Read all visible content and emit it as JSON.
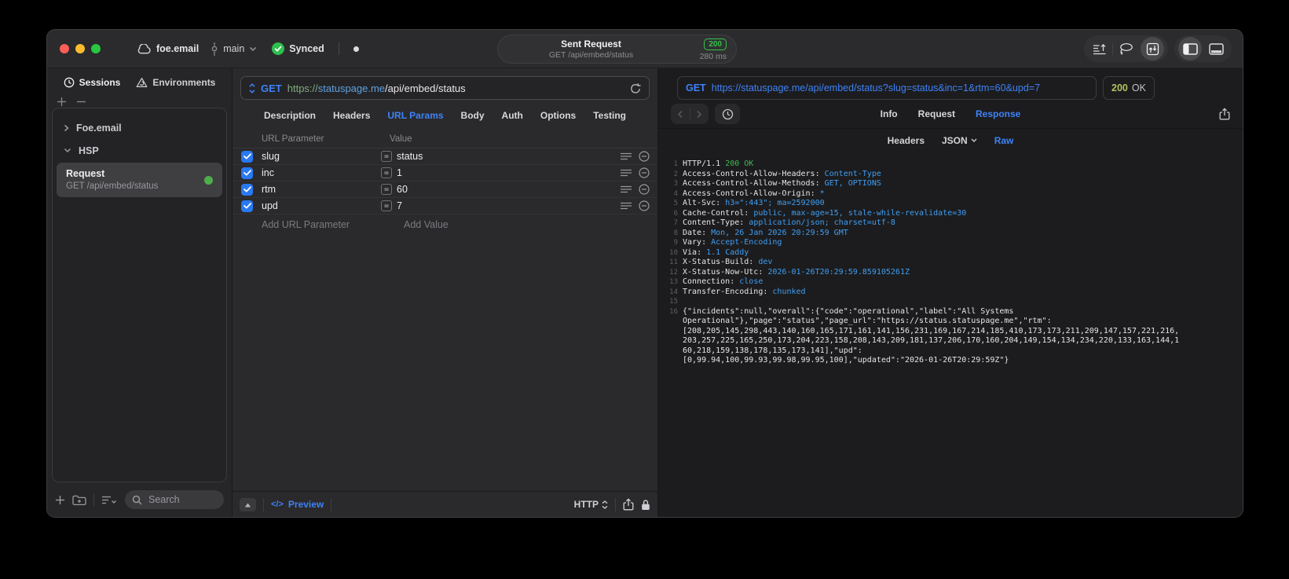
{
  "titlebar": {
    "project": "foe.email",
    "branch": "main",
    "synced_label": "Synced",
    "sent_request": {
      "title": "Sent Request",
      "status_code": "200",
      "subtitle": "GET /api/embed/status",
      "duration": "280 ms"
    },
    "icons": [
      "export-lines-icon",
      "lasso-icon",
      "sync-box-icon",
      "panel-left-icon",
      "panel-bottom-icon"
    ]
  },
  "sidebar": {
    "tabs": [
      {
        "label": "Sessions",
        "icon": "clock-icon",
        "active": true
      },
      {
        "label": "Environments",
        "icon": "environments-icon",
        "active": false
      }
    ],
    "groups": [
      {
        "label": "Foe.email",
        "expanded": false
      },
      {
        "label": "HSP",
        "expanded": true
      }
    ],
    "request_item": {
      "title": "Request",
      "subtitle": "GET /api/embed/status",
      "status_dot_color": "#4fae4c"
    },
    "search_placeholder": "Search"
  },
  "request_editor": {
    "method": "GET",
    "url": {
      "scheme": "https://",
      "host": "statuspage.me",
      "path": "/api/embed/status"
    },
    "tabs": [
      "Description",
      "Headers",
      "URL Params",
      "Body",
      "Auth",
      "Options",
      "Testing"
    ],
    "active_tab": "URL Params",
    "params": {
      "col_param": "URL Parameter",
      "col_value": "Value",
      "operator": "=",
      "rows": [
        {
          "name": "slug",
          "value": "status",
          "checked": true
        },
        {
          "name": "inc",
          "value": "1",
          "checked": true
        },
        {
          "name": "rtm",
          "value": "60",
          "checked": true
        },
        {
          "name": "upd",
          "value": "7",
          "checked": true
        }
      ],
      "add_param": "Add URL Parameter",
      "add_value": "Add Value"
    },
    "footer": {
      "code_glyph": "</>",
      "preview": "Preview",
      "http": "HTTP"
    }
  },
  "response_viewer": {
    "method": "GET",
    "url": "https://statuspage.me/api/embed/status?slug=status&inc=1&rtm=60&upd=7",
    "status_code": "200",
    "status_text": "OK",
    "tabs": [
      "Info",
      "Request",
      "Response"
    ],
    "active_tab": "Response",
    "subtabs": [
      "Headers",
      "JSON",
      "Raw"
    ],
    "active_subtab": "Raw",
    "separator": ": ",
    "http_line": {
      "prefix": "HTTP/1.1 ",
      "status": "200 OK"
    },
    "headers": [
      {
        "name": "Access-Control-Allow-Headers",
        "value": "Content-Type"
      },
      {
        "name": "Access-Control-Allow-Methods",
        "value": "GET, OPTIONS"
      },
      {
        "name": "Access-Control-Allow-Origin",
        "value": "*"
      },
      {
        "name": "Alt-Svc",
        "value": "h3=\":443\"; ma=2592000"
      },
      {
        "name": "Cache-Control",
        "value": "public, max-age=15, stale-while-revalidate=30"
      },
      {
        "name": "Content-Type",
        "value": "application/json; charset=utf-8"
      },
      {
        "name": "Date",
        "value": "Mon, 26 Jan 2026 20:29:59 GMT"
      },
      {
        "name": "Vary",
        "value": "Accept-Encoding"
      },
      {
        "name": "Via",
        "value": "1.1 Caddy"
      },
      {
        "name": "X-Status-Build",
        "value": "dev"
      },
      {
        "name": "X-Status-Now-Utc",
        "value": "2026-01-26T20:29:59.859105261Z"
      },
      {
        "name": "Connection",
        "value": "close"
      },
      {
        "name": "Transfer-Encoding",
        "value": "chunked"
      }
    ],
    "body_line_number": 16,
    "body_lines": [
      "{\"incidents\":null,\"overall\":{\"code\":\"operational\",\"label\":\"All Systems",
      "Operational\"},\"page\":\"status\",\"page_url\":\"https://status.statuspage.me\",\"rtm\":",
      "[208,205,145,298,443,140,160,165,171,161,141,156,231,169,167,214,185,410,173,173,211,209,147,157,221,216,",
      "203,257,225,165,250,173,204,223,158,208,143,209,181,137,206,170,160,204,149,154,134,234,220,133,163,144,1",
      "60,218,159,138,178,135,173,141],\"upd\":",
      "[0,99.94,100,99.93,99.98,99.95,100],\"updated\":\"2026-01-26T20:29:59Z\"}"
    ]
  },
  "colors": {
    "accent_blue": "#3e82f7",
    "success_green": "#32c44c",
    "status200_olive": "#b4c05f",
    "response_value_blue": "#3f9ef2",
    "response_green": "#3fb950",
    "checkbox_blue": "#2979f2"
  }
}
